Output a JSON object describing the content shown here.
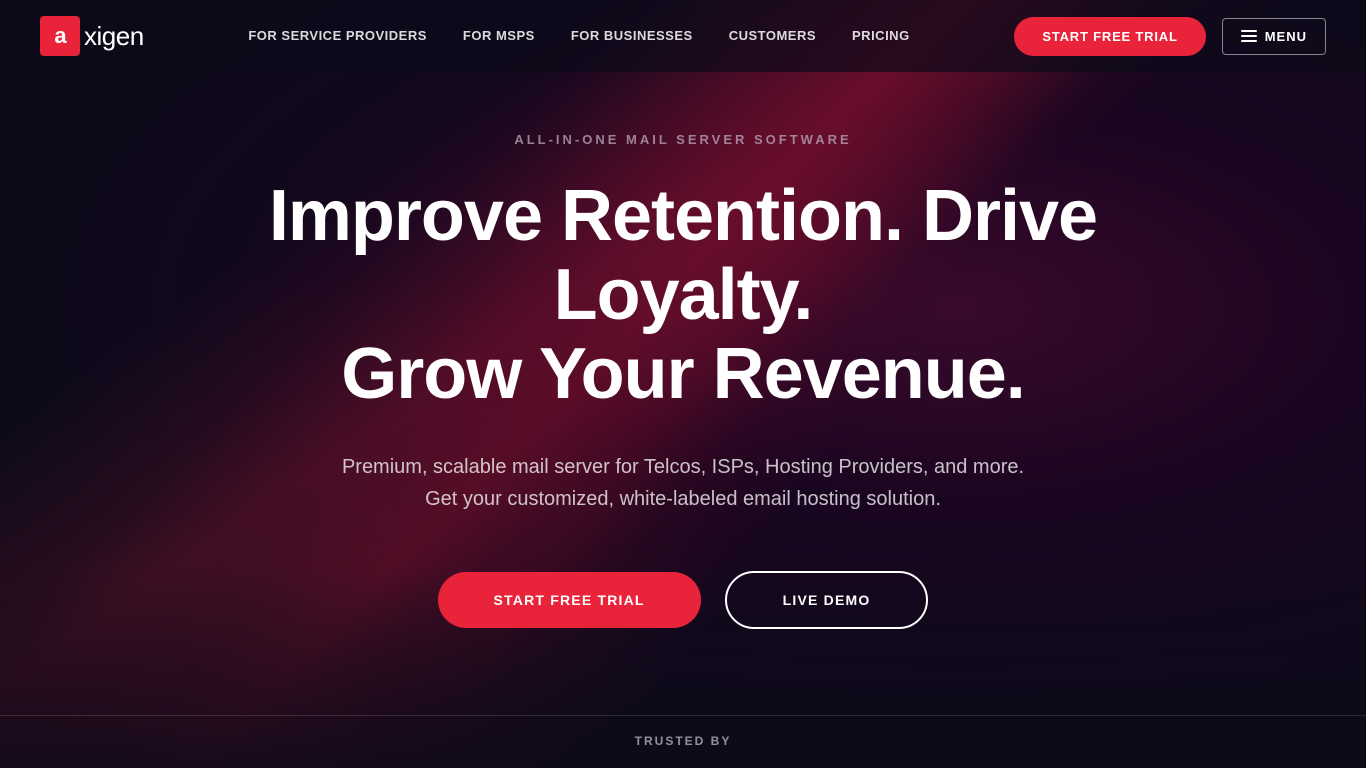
{
  "nav": {
    "logo_letter": "a",
    "logo_word": "xigen",
    "links": [
      {
        "id": "for-service-providers",
        "label": "FOR SERVICE PROVIDERS"
      },
      {
        "id": "for-msps",
        "label": "FOR MSPs"
      },
      {
        "id": "for-businesses",
        "label": "FOR BUSINESSES"
      },
      {
        "id": "customers",
        "label": "CUSTOMERS"
      },
      {
        "id": "pricing",
        "label": "PRICING"
      }
    ],
    "trial_button": "START FREE TRIAL",
    "menu_button": "MENU"
  },
  "hero": {
    "eyebrow": "ALL-IN-ONE MAIL SERVER SOFTWARE",
    "headline_line1": "Improve Retention. Drive Loyalty.",
    "headline_line2": "Grow Your Revenue.",
    "subtext_line1": "Premium, scalable mail server for Telcos, ISPs, Hosting Providers, and more.",
    "subtext_line2": "Get your customized, white-labeled email hosting solution.",
    "trial_button": "START FREE TRIAL",
    "demo_button": "LIVE DEMO"
  },
  "trusted": {
    "label": "TRUSTED BY"
  },
  "colors": {
    "accent": "#e8233a",
    "background": "#0d0a1a"
  }
}
